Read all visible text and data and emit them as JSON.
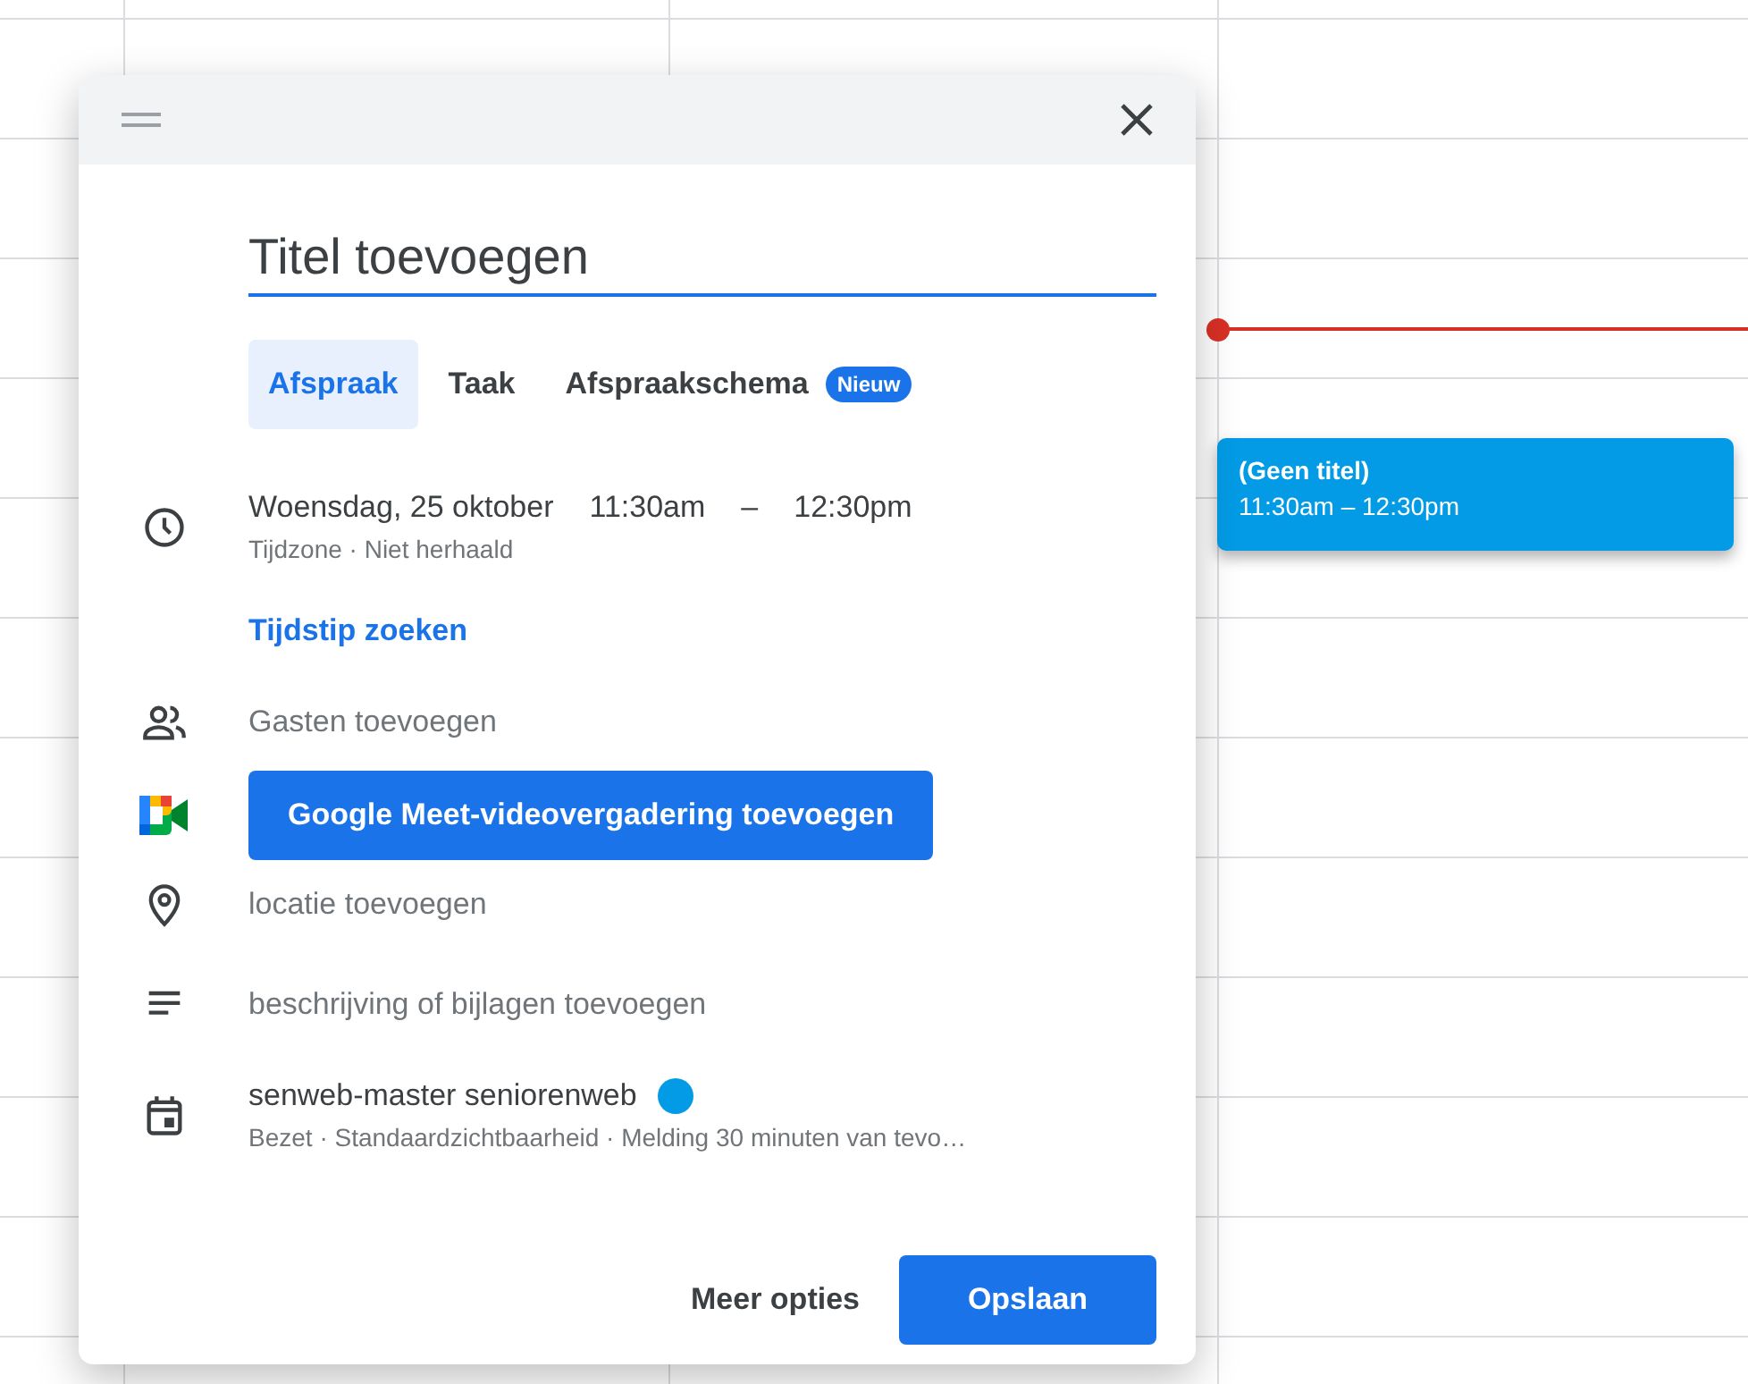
{
  "dialog": {
    "title_field": {
      "placeholder": "Titel toevoegen"
    },
    "tabs": [
      {
        "label": "Afspraak",
        "selected": true
      },
      {
        "label": "Taak",
        "selected": false
      },
      {
        "label": "Afspraakschema",
        "selected": false,
        "badge": "Nieuw"
      }
    ],
    "date": "Woensdag, 25 oktober",
    "start": "11:30am",
    "separator": "–",
    "end": "12:30pm",
    "date_details": "Tijdzone · Niet herhaald",
    "find_time_link": "Tijdstip zoeken",
    "guests": "Gasten toevoegen",
    "meet_button": "Google Meet-videovergadering toevoegen",
    "location": "locatie toevoegen",
    "description": "beschrijving of bijlagen toevoegen",
    "calendar": {
      "name": "senweb-master seniorenweb",
      "details": "Bezet · Standaardzichtbaarheid · Melding 30 minuten van tevo…"
    },
    "more_options": "Meer opties",
    "save": "Opslaan"
  },
  "event": {
    "title": "(Geen titel)",
    "time": "11:30am – 12:30pm"
  }
}
